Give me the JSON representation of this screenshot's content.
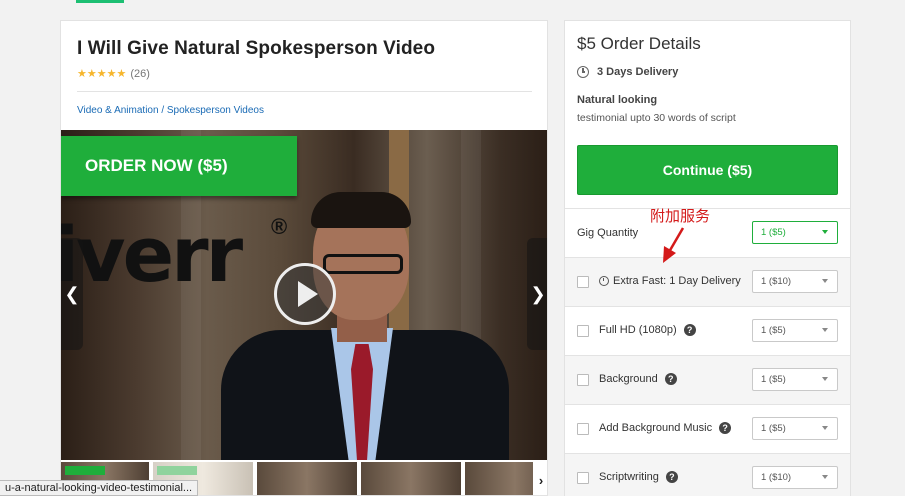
{
  "gig": {
    "title": "I Will Give Natural Spokesperson Video",
    "stars": "★★★★★",
    "reviews": "(26)",
    "breadcrumb_category": "Video & Animation",
    "breadcrumb_sep": " / ",
    "breadcrumb_subcategory": "Spokesperson Videos"
  },
  "video": {
    "order_now": "ORDER NOW ($5)",
    "logo_text": "iverr",
    "reg_mark": "®",
    "prev_arrow": "❮",
    "next_arrow": "❯",
    "thumb_next": "›"
  },
  "status_bar": {
    "url": "u-a-natural-looking-video-testimonial..."
  },
  "order": {
    "title": "$5 Order Details",
    "delivery": "3 Days Delivery",
    "package_title": "Natural looking",
    "package_desc": "testimonial upto 30 words of script",
    "continue_label": "Continue ($5)",
    "gig_quantity_label": "Gig Quantity",
    "gig_quantity_value": "1 ($5)",
    "extras": [
      {
        "label": "Extra Fast: 1 Day Delivery",
        "value": "1 ($10)"
      },
      {
        "label": "Full HD (1080p)",
        "value": "1 ($5)"
      },
      {
        "label": "Background",
        "value": "1 ($5)"
      },
      {
        "label": "Add Background Music",
        "value": "1 ($5)"
      },
      {
        "label": "Scriptwriting",
        "value": "1 ($10)"
      }
    ],
    "help_glyph": "?"
  },
  "annotation": {
    "text": "附加服务",
    "color": "#d41a1a"
  },
  "colors": {
    "accent_green": "#1fae3b",
    "link_blue": "#1a6bb5",
    "star_gold": "#f6b62d"
  }
}
